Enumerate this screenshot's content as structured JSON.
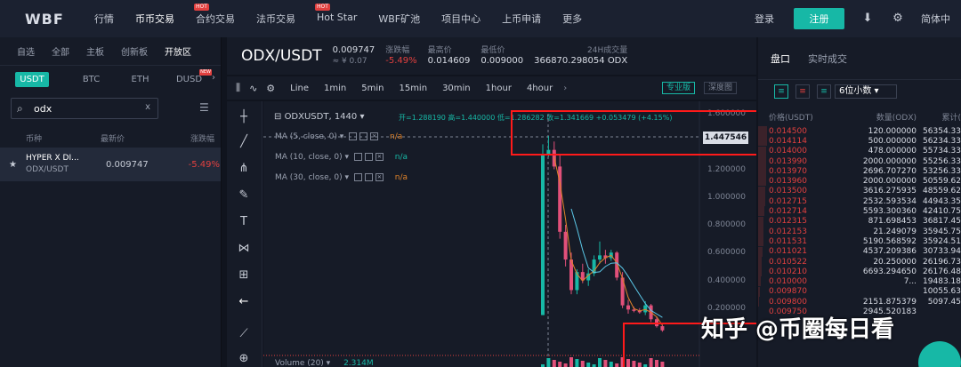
{
  "nav": {
    "logo": "WBF",
    "items": [
      {
        "label": "行情",
        "hot": ""
      },
      {
        "label": "币币交易",
        "hot": ""
      },
      {
        "label": "合约交易",
        "hot": "HOT"
      },
      {
        "label": "法币交易",
        "hot": ""
      },
      {
        "label": "Hot Star",
        "hot": "HOT"
      },
      {
        "label": "WBF矿池",
        "hot": ""
      },
      {
        "label": "项目中心",
        "hot": ""
      },
      {
        "label": "上币申请",
        "hot": ""
      },
      {
        "label": "更多",
        "hot": ""
      }
    ],
    "login": "登录",
    "register": "注册",
    "language": "简体中"
  },
  "market": {
    "tabs": [
      "自选",
      "全部",
      "主板",
      "创新板",
      "开放区"
    ],
    "coin_tabs": [
      "USDT",
      "BTC",
      "ETH",
      "DUSD"
    ],
    "coin_new_badge": "NEW",
    "search_value": "odx",
    "columns": [
      "币种",
      "最新价",
      "涨跌幅"
    ],
    "rows": [
      {
        "name": "HYPER X DI...",
        "pair": "ODX/USDT",
        "price": "0.009747",
        "change": "-5.49%"
      }
    ]
  },
  "ticker": {
    "pair": "ODX/USDT",
    "price": "0.009747",
    "price_cny": "≈ ¥ 0.07",
    "change_label": "涨跌幅",
    "change": "-5.49%",
    "high_label": "最高价",
    "high": "0.014609",
    "low_label": "最低价",
    "low": "0.009000",
    "volume_label": "24H成交量",
    "volume": "366870.298054 ODX"
  },
  "chart_toolbar": {
    "periods": [
      "Line",
      "1min",
      "5min",
      "15min",
      "30min",
      "1hour",
      "4hour"
    ],
    "pro": "专业版",
    "depth": "深度图"
  },
  "chart": {
    "title": "ODXUSDT, 1440",
    "ohlc": "开=1.288190 高=1.440000 低=1.286282 收=1.341669 +0.053479 (+4.15%)",
    "ma5": "MA (5, close, 0)",
    "ma10": "MA (10, close, 0)",
    "ma30": "MA (30, close, 0)",
    "na": "n/a",
    "price_tag": "1.447546",
    "volume_label": "Volume (20)",
    "volume_value": "2.314M",
    "y_ticks": [
      "1.600000",
      "1.400000",
      "1.200000",
      "1.000000",
      "0.800000",
      "0.600000",
      "0.400000",
      "0.200000"
    ]
  },
  "chart_data": {
    "type": "candlestick",
    "ylim": [
      0.0,
      1.6
    ],
    "candles": [
      {
        "o": 0.15,
        "h": 1.38,
        "l": 0.15,
        "c": 1.3
      },
      {
        "o": 1.3,
        "h": 1.44,
        "l": 1.29,
        "c": 1.34
      },
      {
        "o": 1.34,
        "h": 1.4,
        "l": 1.2,
        "c": 1.22
      },
      {
        "o": 1.22,
        "h": 1.3,
        "l": 0.7,
        "c": 0.75
      },
      {
        "o": 0.75,
        "h": 0.8,
        "l": 0.5,
        "c": 0.55
      },
      {
        "o": 0.55,
        "h": 0.6,
        "l": 0.3,
        "c": 0.33
      },
      {
        "o": 0.33,
        "h": 0.48,
        "l": 0.3,
        "c": 0.46
      },
      {
        "o": 0.46,
        "h": 0.52,
        "l": 0.38,
        "c": 0.4
      },
      {
        "o": 0.4,
        "h": 0.48,
        "l": 0.36,
        "c": 0.45
      },
      {
        "o": 0.45,
        "h": 0.58,
        "l": 0.43,
        "c": 0.55
      },
      {
        "o": 0.55,
        "h": 0.68,
        "l": 0.52,
        "c": 0.58
      },
      {
        "o": 0.58,
        "h": 0.62,
        "l": 0.52,
        "c": 0.56
      },
      {
        "o": 0.56,
        "h": 0.62,
        "l": 0.54,
        "c": 0.6
      },
      {
        "o": 0.6,
        "h": 0.61,
        "l": 0.4,
        "c": 0.42
      },
      {
        "o": 0.42,
        "h": 0.46,
        "l": 0.2,
        "c": 0.22
      },
      {
        "o": 0.22,
        "h": 0.26,
        "l": 0.16,
        "c": 0.19
      },
      {
        "o": 0.19,
        "h": 0.21,
        "l": 0.17,
        "c": 0.18
      },
      {
        "o": 0.18,
        "h": 0.2,
        "l": 0.16,
        "c": 0.17
      },
      {
        "o": 0.17,
        "h": 0.25,
        "l": 0.15,
        "c": 0.22
      },
      {
        "o": 0.22,
        "h": 0.23,
        "l": 0.1,
        "c": 0.12
      },
      {
        "o": 0.12,
        "h": 0.14,
        "l": 0.06,
        "c": 0.07
      },
      {
        "o": 0.07,
        "h": 0.08,
        "l": 0.03,
        "c": 0.04
      }
    ]
  },
  "book": {
    "tabs": [
      "盘口",
      "实时成交"
    ],
    "precision": "6位小数",
    "columns": [
      "价格(USDT)",
      "数量(ODX)",
      "累计("
    ],
    "asks": [
      {
        "price": "0.014500",
        "amount": "120.000000",
        "total": "56354.33",
        "depth": 0.8
      },
      {
        "price": "0.014114",
        "amount": "500.000000",
        "total": "56234.33",
        "depth": 0.8
      },
      {
        "price": "0.014000",
        "amount": "478.000000",
        "total": "55734.33",
        "depth": 0.79
      },
      {
        "price": "0.013990",
        "amount": "2000.000000",
        "total": "55256.33",
        "depth": 0.78
      },
      {
        "price": "0.013970",
        "amount": "2696.707270",
        "total": "53256.33",
        "depth": 0.75
      },
      {
        "price": "0.013960",
        "amount": "2000.000000",
        "total": "50559.62",
        "depth": 0.72
      },
      {
        "price": "0.013500",
        "amount": "3616.275935",
        "total": "48559.62",
        "depth": 0.69
      },
      {
        "price": "0.012715",
        "amount": "2532.593534",
        "total": "44943.35",
        "depth": 0.64
      },
      {
        "price": "0.012714",
        "amount": "5593.300360",
        "total": "42410.75",
        "depth": 0.6
      },
      {
        "price": "0.012315",
        "amount": "871.698453",
        "total": "36817.45",
        "depth": 0.52
      },
      {
        "price": "0.012153",
        "amount": "21.249079",
        "total": "35945.75",
        "depth": 0.51
      },
      {
        "price": "0.011531",
        "amount": "5190.568592",
        "total": "35924.51",
        "depth": 0.51
      },
      {
        "price": "0.011021",
        "amount": "4537.209386",
        "total": "30733.94",
        "depth": 0.44
      },
      {
        "price": "0.010522",
        "amount": "20.250000",
        "total": "26196.73",
        "depth": 0.37
      },
      {
        "price": "0.010210",
        "amount": "6693.294650",
        "total": "26176.48",
        "depth": 0.37
      },
      {
        "price": "0.010000",
        "amount": "7...",
        "total": "19483.18",
        "depth": 0.28
      },
      {
        "price": "0.009870",
        "amount": "",
        "total": "10055.63",
        "depth": 0.14
      },
      {
        "price": "0.009800",
        "amount": "2151.875379",
        "total": "5097.45",
        "depth": 0.07
      },
      {
        "price": "0.009750",
        "amount": "2945.520183",
        "total": "",
        "depth": 0.04
      }
    ]
  },
  "watermark": "知乎 @币圈每日看"
}
